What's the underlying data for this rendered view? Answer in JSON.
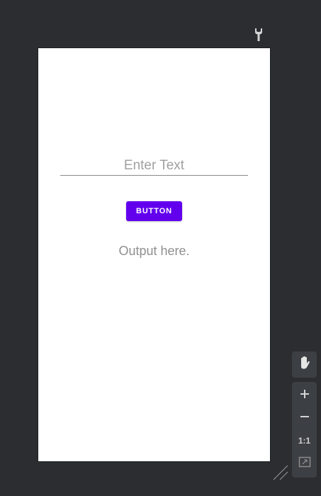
{
  "toolbar": {
    "wrench_icon": "wrench-icon"
  },
  "device": {
    "input": {
      "placeholder": "Enter Text",
      "value": ""
    },
    "button_label": "BUTTON",
    "output_text": "Output here."
  },
  "zoom_controls": {
    "pan_icon": "hand-icon",
    "zoom_in_icon": "plus-icon",
    "zoom_out_icon": "minus-icon",
    "actual_size_label": "1:1",
    "zoom_to_fit_icon": "fit-screen-icon",
    "resize_icon": "resize-handle-icon"
  },
  "colors": {
    "canvas_background": "#2b2d30",
    "device_background": "#ffffff",
    "button_accent": "#6200ee",
    "hint_text": "#a0a0a0",
    "panel_background": "#3c3f43"
  }
}
